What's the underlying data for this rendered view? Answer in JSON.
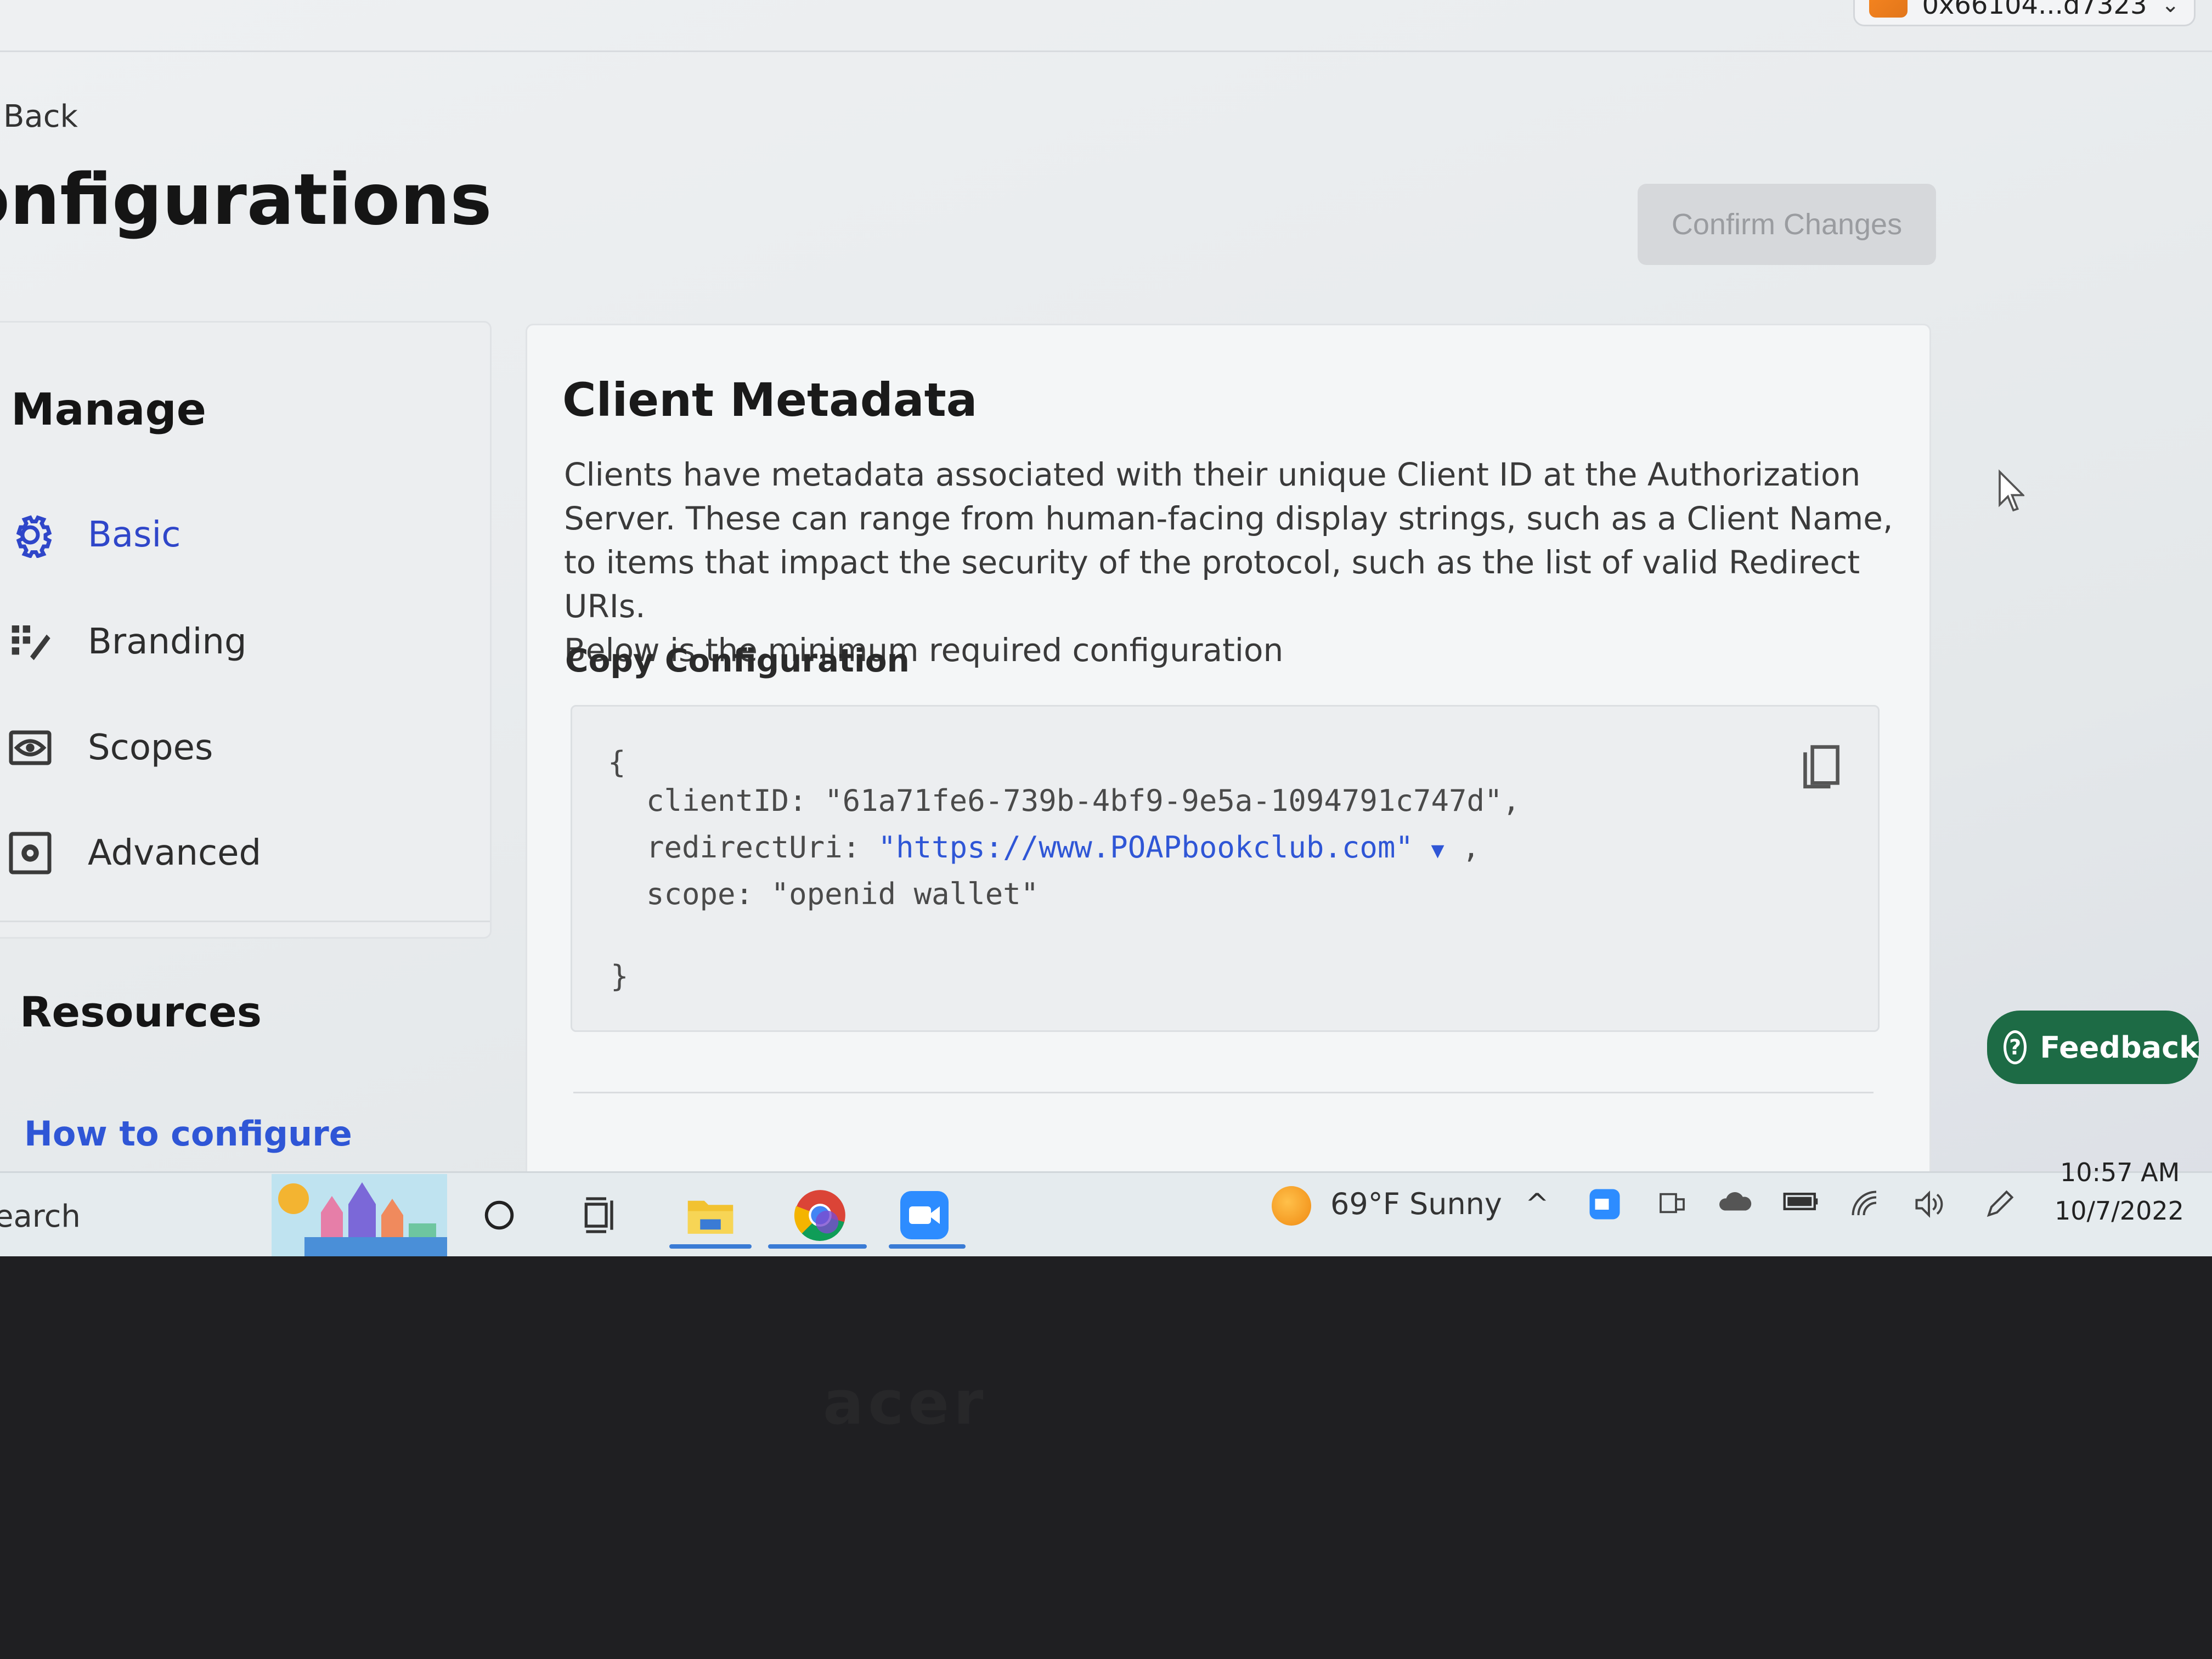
{
  "wallet": {
    "address": "0x66104...d7323"
  },
  "nav": {
    "back_label": "Back"
  },
  "page": {
    "title": "onfigurations",
    "confirm_label": "Confirm Changes"
  },
  "sidebar": {
    "heading": "Manage",
    "items": [
      {
        "label": "Basic",
        "icon": "gear-icon",
        "active": true
      },
      {
        "label": "Branding",
        "icon": "palette-icon",
        "active": false
      },
      {
        "label": "Scopes",
        "icon": "eye-icon",
        "active": false
      },
      {
        "label": "Advanced",
        "icon": "settings-box-icon",
        "active": false
      }
    ],
    "resources_heading": "Resources",
    "resources_link": "How to configure"
  },
  "metadata": {
    "title": "Client Metadata",
    "description": "Clients have metadata associated with their unique Client ID at the Authorization Server. These can range from human-facing display strings, such as a Client Name, to items that impact the security of the protocol, such as the list of valid Redirect URIs.",
    "note": "Below is the minimum required configuration",
    "copy_label": "Copy Configuration",
    "code": {
      "open": "{",
      "client_key": "clientID: ",
      "client_value": "\"61a71fe6-739b-4bf9-9e5a-1094791c747d\",",
      "redirect_key": "redirectUri: ",
      "redirect_value": "\"https://www.POAPbookclub.com\"",
      "redirect_caret": "▼",
      "redirect_comma": " ,",
      "scope_key": "scope: ",
      "scope_value": "\"openid wallet\"",
      "close": "}"
    }
  },
  "feedback": {
    "label": "Feedback"
  },
  "taskbar": {
    "search": "earch",
    "weather": "69°F  Sunny",
    "time": "10:57 AM",
    "date": "10/7/2022"
  },
  "colors": {
    "accent": "#2f46c9",
    "link": "#2f56d6",
    "feedback": "#1d6b45"
  }
}
